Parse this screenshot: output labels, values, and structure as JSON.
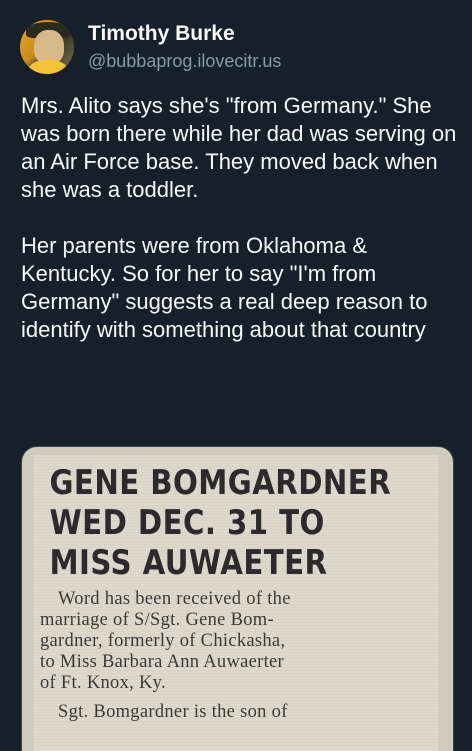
{
  "author": {
    "display_name": "Timothy Burke",
    "handle": "@bubbaprog.ilovecitr.us"
  },
  "tweet": {
    "text": "Mrs. Alito says she's \"from Germany.\" She was born there while her dad was serving on an Air Force base. They moved back when she was a toddler.\n\nHer parents were from Oklahoma & Kentucky. So for her to say \"I'm from Germany\" suggests a real deep reason to identify with something about that country"
  },
  "clipping": {
    "headline": "GENE BOMGARDNER\nWED DEC. 31 TO\nMISS AUWAETER",
    "paragraph_1": "Word has been received of the\nmarriage of S/Sgt. Gene Bom-\ngardner, formerly of Chickasha,\nto Miss Barbara Ann Auwaerter\nof Ft. Knox, Ky.",
    "paragraph_2": "Sgt. Bomgardner is the son of"
  },
  "colors": {
    "background": "#15202b",
    "text_primary": "#f7f9f9",
    "text_secondary": "#8b98a5"
  }
}
